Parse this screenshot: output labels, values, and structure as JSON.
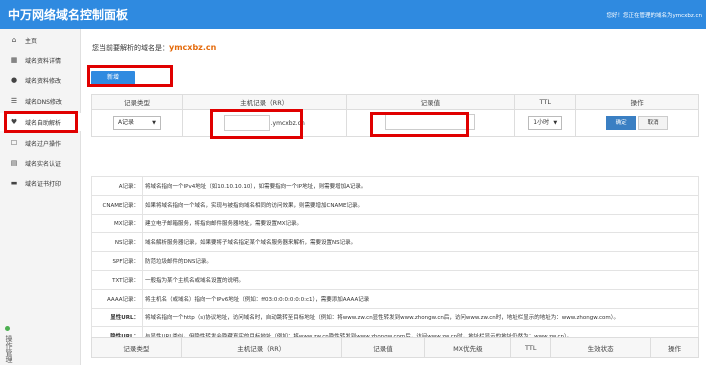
{
  "header": {
    "title": "中万网络域名控制面板",
    "welcome": "您好！您正在管理的域名为ymcxbz.cn"
  },
  "sidebar": {
    "items": [
      {
        "label": "主页",
        "icon": "home-icon",
        "glyph": "⌂"
      },
      {
        "label": "域名资料详情",
        "icon": "grid-icon",
        "glyph": "▦"
      },
      {
        "label": "域名资料修改",
        "icon": "user-icon",
        "glyph": "●"
      },
      {
        "label": "域名DNS修改",
        "icon": "list-icon",
        "glyph": "☰"
      },
      {
        "label": "域名自助解析",
        "icon": "heart-icon",
        "glyph": "♥"
      },
      {
        "label": "域名过户操作",
        "icon": "square-icon",
        "glyph": "☐"
      },
      {
        "label": "域名实名认证",
        "icon": "id-card-icon",
        "glyph": "▤"
      },
      {
        "label": "域名证书打印",
        "icon": "folder-icon",
        "glyph": "▬"
      }
    ],
    "bottom_text": "操作管理"
  },
  "main": {
    "domain_prefix": "您当前要解析的域名是：",
    "domain_name": "ymcxbz.cn",
    "add_button": "新增"
  },
  "record_form": {
    "headers": [
      "记录类型",
      "主机记录（RR）",
      "记录值",
      "TTL",
      "操作"
    ],
    "type_value": "A记录",
    "host_value": "",
    "host_suffix": ".ymcxbz.cn",
    "record_value": "",
    "ttl_value": "1小时",
    "confirm_button": "确定",
    "cancel_button": "取消"
  },
  "help_rows": [
    {
      "key": "A记录：",
      "desc": "将域名指向一个IPv4地址（如10.10.10.10），如需要指向一个IP地址，则需要增加A记录。",
      "bold": false
    },
    {
      "key": "CNAME记录：",
      "desc": "如果将域名指向一个域名，实现与被指向域名相同的访问效果，则需要增加CNAME记录。",
      "bold": false
    },
    {
      "key": "MX记录：",
      "desc": "建立电子邮箱服务，将指向邮件服务器地址，需要设置MX记录。",
      "bold": false
    },
    {
      "key": "NS记录：",
      "desc": "域名解析服务器记录，如果要将子域名指定某个域名服务器来解析，需要设置NS记录。",
      "bold": false
    },
    {
      "key": "SPF记录：",
      "desc": "防范垃圾邮件的DNS记录。",
      "bold": false
    },
    {
      "key": "TXT记录：",
      "desc": "一般指为某个主机名或域名设置的说明。",
      "bold": false
    },
    {
      "key": "AAAA记录：",
      "desc": "将主机名（或域名）指向一个IPv6地址（例如：ff03:0:0:0:0:0:0:c1），需要添加AAAA记录",
      "bold": false
    },
    {
      "key": "显性URL：",
      "desc": "将域名指向一个http（s)协议地址，访问域名时，自动跳转至目标地址（例如：将www.zw.cn显性转发到www.zhongw.cn后，访问www.zw.cn时，地址栏显示的地址为：www.zhongw.com）。",
      "bold": true
    },
    {
      "key": "隐性URL：",
      "desc": "与显性URL类似，但隐性转发会隐藏真实的目标地址（例如：将www.zw.cn隐性转发到www.zhongw.com后，访问www.zw.cn时，地址栏显示的地址仍然为：www.zw.cn）。",
      "bold": true
    }
  ],
  "list_table": {
    "headers": [
      "记录类型",
      "主机记录（RR）",
      "记录值",
      "MX优先级",
      "TTL",
      "生效状态",
      "操作"
    ]
  }
}
